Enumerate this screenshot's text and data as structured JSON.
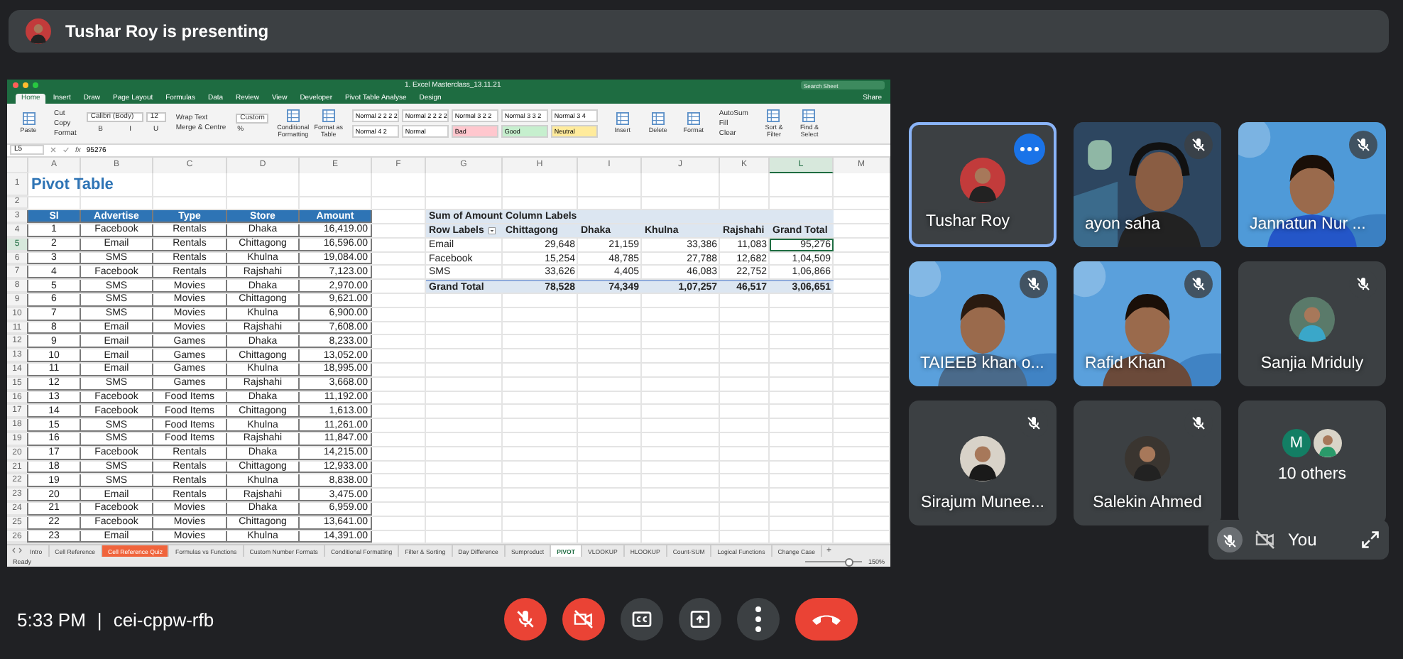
{
  "banner": {
    "text": "Tushar Roy is presenting"
  },
  "excel": {
    "title": "1. Excel Masterclass_13.11.21",
    "search": {
      "placeholder": "Search Sheet"
    },
    "share": "Share",
    "tabs": [
      {
        "label": "Home",
        "selected": true
      },
      {
        "label": "Insert",
        "selected": false
      },
      {
        "label": "Draw",
        "selected": false
      },
      {
        "label": "Page Layout",
        "selected": false
      },
      {
        "label": "Formulas",
        "selected": false
      },
      {
        "label": "Data",
        "selected": false
      },
      {
        "label": "Review",
        "selected": false
      },
      {
        "label": "View",
        "selected": false
      },
      {
        "label": "Developer",
        "selected": false
      },
      {
        "label": "Pivot Table Analyse",
        "selected": false
      },
      {
        "label": "Design",
        "selected": false
      }
    ],
    "ribbon": [
      {
        "kind": "row",
        "items": [
          {
            "kind": "big",
            "label": "Paste"
          }
        ]
      },
      {
        "kind": "stack",
        "items": [
          {
            "kind": "small",
            "label": "Cut"
          },
          {
            "kind": "small",
            "label": "Copy"
          },
          {
            "kind": "small",
            "label": "Format"
          }
        ]
      },
      {
        "kind": "grid2",
        "items": [
          {
            "kind": "field",
            "label": "Calibri (Body)"
          },
          {
            "kind": "field",
            "label": "12"
          },
          {
            "kind": "small",
            "label": "B"
          },
          {
            "kind": "small",
            "label": "I"
          },
          {
            "kind": "small",
            "label": "U"
          }
        ]
      },
      {
        "kind": "stack",
        "items": [
          {
            "kind": "small",
            "label": "Wrap Text"
          },
          {
            "kind": "small",
            "label": "Merge & Centre"
          }
        ]
      },
      {
        "kind": "stack",
        "items": [
          {
            "kind": "field",
            "label": "Custom"
          },
          {
            "kind": "small",
            "label": "%"
          }
        ]
      },
      {
        "kind": "row",
        "items": [
          {
            "kind": "big",
            "label": "Conditional Formatting"
          },
          {
            "kind": "big",
            "label": "Format as Table"
          }
        ]
      },
      {
        "kind": "styles",
        "items": [
          {
            "kind": "style",
            "label": "Normal 2 2 2 2",
            "color": "#ffffff"
          },
          {
            "kind": "style",
            "label": "Normal 2 2 2 2",
            "color": "#ffffff"
          },
          {
            "kind": "style",
            "label": "Normal 3 2 2",
            "color": "#ffffff"
          },
          {
            "kind": "style",
            "label": "Normal 3 3 2",
            "color": "#ffffff"
          },
          {
            "kind": "style",
            "label": "Normal 3 4",
            "color": "#ffffff"
          },
          {
            "kind": "style",
            "label": "Normal 4 2",
            "color": "#ffffff"
          },
          {
            "kind": "style",
            "label": "Normal",
            "color": "#ffffff"
          },
          {
            "kind": "style",
            "label": "Bad",
            "color": "#ffc7ce"
          },
          {
            "kind": "style",
            "label": "Good",
            "color": "#c6efce"
          },
          {
            "kind": "style",
            "label": "Neutral",
            "color": "#ffeb9c"
          }
        ]
      },
      {
        "kind": "row",
        "items": [
          {
            "kind": "big",
            "label": "Insert"
          },
          {
            "kind": "big",
            "label": "Delete"
          },
          {
            "kind": "big",
            "label": "Format"
          }
        ]
      },
      {
        "kind": "stack",
        "items": [
          {
            "kind": "small",
            "label": "AutoSum"
          },
          {
            "kind": "small",
            "label": "Fill"
          },
          {
            "kind": "small",
            "label": "Clear"
          }
        ]
      },
      {
        "kind": "row",
        "items": [
          {
            "kind": "big",
            "label": "Sort & Filter"
          },
          {
            "kind": "big",
            "label": "Find & Select"
          }
        ]
      }
    ],
    "formula_bar": {
      "cell": "L5",
      "function_label": "fx",
      "value": "95276"
    },
    "sheet": {
      "columns": [
        {
          "label": "A",
          "selected": false
        },
        {
          "label": "B",
          "selected": false
        },
        {
          "label": "C",
          "selected": false
        },
        {
          "label": "D",
          "selected": false
        },
        {
          "label": "E",
          "selected": false
        },
        {
          "label": "F",
          "selected": false
        },
        {
          "label": "G",
          "selected": false
        },
        {
          "label": "H",
          "selected": false
        },
        {
          "label": "I",
          "selected": false
        },
        {
          "label": "J",
          "selected": false
        },
        {
          "label": "K",
          "selected": false
        },
        {
          "label": "L",
          "selected": true
        },
        {
          "label": "M",
          "selected": false
        }
      ],
      "row_numbers": [
        {
          "label": "1",
          "selected": false
        },
        {
          "label": "2",
          "selected": false
        },
        {
          "label": "3",
          "selected": false
        },
        {
          "label": "4",
          "selected": false
        },
        {
          "label": "5",
          "selected": true
        },
        {
          "label": "6",
          "selected": false
        },
        {
          "label": "7",
          "selected": false
        },
        {
          "label": "8",
          "selected": false
        },
        {
          "label": "9",
          "selected": false
        },
        {
          "label": "10",
          "selected": false
        },
        {
          "label": "11",
          "selected": false
        },
        {
          "label": "12",
          "selected": false
        },
        {
          "label": "13",
          "selected": false
        },
        {
          "label": "14",
          "selected": false
        },
        {
          "label": "15",
          "selected": false
        },
        {
          "label": "16",
          "selected": false
        },
        {
          "label": "17",
          "selected": false
        },
        {
          "label": "18",
          "selected": false
        },
        {
          "label": "19",
          "selected": false
        },
        {
          "label": "20",
          "selected": false
        },
        {
          "label": "21",
          "selected": false
        },
        {
          "label": "22",
          "selected": false
        },
        {
          "label": "23",
          "selected": false
        },
        {
          "label": "24",
          "selected": false
        },
        {
          "label": "25",
          "selected": false
        },
        {
          "label": "26",
          "selected": false
        }
      ],
      "title": "Pivot Table",
      "data_table": {
        "columns": [
          "Sl",
          "Advertise",
          "Type",
          "Store",
          "Amount"
        ],
        "rows": [
          [
            "1",
            "Facebook",
            "Rentals",
            "Dhaka",
            "16,419.00"
          ],
          [
            "2",
            "Email",
            "Rentals",
            "Chittagong",
            "16,596.00"
          ],
          [
            "3",
            "SMS",
            "Rentals",
            "Khulna",
            "19,084.00"
          ],
          [
            "4",
            "Facebook",
            "Rentals",
            "Rajshahi",
            "7,123.00"
          ],
          [
            "5",
            "SMS",
            "Movies",
            "Dhaka",
            "2,970.00"
          ],
          [
            "6",
            "SMS",
            "Movies",
            "Chittagong",
            "9,621.00"
          ],
          [
            "7",
            "SMS",
            "Movies",
            "Khulna",
            "6,900.00"
          ],
          [
            "8",
            "Email",
            "Movies",
            "Rajshahi",
            "7,608.00"
          ],
          [
            "9",
            "Email",
            "Games",
            "Dhaka",
            "8,233.00"
          ],
          [
            "10",
            "Email",
            "Games",
            "Chittagong",
            "13,052.00"
          ],
          [
            "11",
            "Email",
            "Games",
            "Khulna",
            "18,995.00"
          ],
          [
            "12",
            "SMS",
            "Games",
            "Rajshahi",
            "3,668.00"
          ],
          [
            "13",
            "Facebook",
            "Food Items",
            "Dhaka",
            "11,192.00"
          ],
          [
            "14",
            "Facebook",
            "Food Items",
            "Chittagong",
            "1,613.00"
          ],
          [
            "15",
            "SMS",
            "Food Items",
            "Khulna",
            "11,261.00"
          ],
          [
            "16",
            "SMS",
            "Food Items",
            "Rajshahi",
            "11,847.00"
          ],
          [
            "17",
            "Facebook",
            "Rentals",
            "Dhaka",
            "14,215.00"
          ],
          [
            "18",
            "SMS",
            "Rentals",
            "Chittagong",
            "12,933.00"
          ],
          [
            "19",
            "SMS",
            "Rentals",
            "Khulna",
            "8,838.00"
          ],
          [
            "20",
            "Email",
            "Rentals",
            "Rajshahi",
            "3,475.00"
          ],
          [
            "21",
            "Facebook",
            "Movies",
            "Dhaka",
            "6,959.00"
          ],
          [
            "22",
            "Facebook",
            "Movies",
            "Chittagong",
            "13,641.00"
          ],
          [
            "23",
            "Email",
            "Movies",
            "Khulna",
            "14,391.00"
          ]
        ]
      },
      "pivot": {
        "corner": "Sum of Amount",
        "column_labels": "Column Labels",
        "row_labels": "Row Labels",
        "columns": [
          "Chittagong",
          "Dhaka",
          "Khulna",
          "Rajshahi",
          "Grand Total"
        ],
        "rows": [
          {
            "kind": "item",
            "label": "Email",
            "values": [
              {
                "text": "29,648",
                "selected": false
              },
              {
                "text": "21,159",
                "selected": false
              },
              {
                "text": "33,386",
                "selected": false
              },
              {
                "text": "11,083",
                "selected": false
              },
              {
                "text": "95,276",
                "selected": true
              }
            ]
          },
          {
            "kind": "item",
            "label": "Facebook",
            "values": [
              {
                "text": "15,254",
                "selected": false
              },
              {
                "text": "48,785",
                "selected": false
              },
              {
                "text": "27,788",
                "selected": false
              },
              {
                "text": "12,682",
                "selected": false
              },
              {
                "text": "1,04,509",
                "selected": false
              }
            ]
          },
          {
            "kind": "item",
            "label": "SMS",
            "values": [
              {
                "text": "33,626",
                "selected": false
              },
              {
                "text": "4,405",
                "selected": false
              },
              {
                "text": "46,083",
                "selected": false
              },
              {
                "text": "22,752",
                "selected": false
              },
              {
                "text": "1,06,866",
                "selected": false
              }
            ]
          },
          {
            "kind": "total",
            "label": "Grand Total",
            "values": [
              {
                "text": "78,528",
                "selected": false
              },
              {
                "text": "74,349",
                "selected": false
              },
              {
                "text": "1,07,257",
                "selected": false
              },
              {
                "text": "46,517",
                "selected": false
              },
              {
                "text": "3,06,651",
                "selected": false
              }
            ]
          }
        ]
      }
    },
    "sheet_tabs": [
      {
        "label": "Intro",
        "selected": false
      },
      {
        "label": "Cell Reference",
        "selected": false
      },
      {
        "label": "Cell Reference Quiz",
        "selected": false,
        "color": "#f0643c"
      },
      {
        "label": "Formulas vs Functions",
        "selected": false
      },
      {
        "label": "Custom Number Formats",
        "selected": false
      },
      {
        "label": "Conditional Formatting",
        "selected": false
      },
      {
        "label": "Filter & Sorting",
        "selected": false
      },
      {
        "label": "Day Difference",
        "selected": false
      },
      {
        "label": "Sumproduct",
        "selected": false
      },
      {
        "label": "PIVOT",
        "selected": true
      },
      {
        "label": "VLOOKUP",
        "selected": false
      },
      {
        "label": "HLOOKUP",
        "selected": false
      },
      {
        "label": "Count-SUM",
        "selected": false
      },
      {
        "label": "Logical Functions",
        "selected": false
      },
      {
        "label": "Change Case",
        "selected": false
      }
    ],
    "add_sheet": "+",
    "status_bar": {
      "text": "Ready",
      "zoom": {
        "level": 0.75,
        "reading": "150%"
      }
    }
  },
  "participants": [
    {
      "name": "Tushar Roy",
      "kind": "avatar",
      "muted": false,
      "selected": true,
      "options_button": true
    },
    {
      "name": "ayon saha",
      "kind": "video",
      "muted": true,
      "selected": false,
      "options_button": false
    },
    {
      "name": "Jannatun Nur ...",
      "kind": "video",
      "muted": true,
      "selected": false,
      "options_button": false
    },
    {
      "name": "TAIEEB khan o...",
      "kind": "video",
      "muted": true,
      "selected": false,
      "options_button": false
    },
    {
      "name": "Rafid Khan",
      "kind": "video",
      "muted": true,
      "selected": false,
      "options_button": false
    },
    {
      "name": "Sanjia Mriduly",
      "kind": "avatar",
      "muted": true,
      "selected": false,
      "options_button": false
    },
    {
      "name": "Sirajum Munee...",
      "kind": "avatar",
      "muted": true,
      "selected": false,
      "options_button": false
    },
    {
      "name": "Salekin Ahmed",
      "kind": "avatar",
      "muted": true,
      "selected": false,
      "options_button": false
    }
  ],
  "others": {
    "initial": "M",
    "label": "10 others"
  },
  "self_view": {
    "label": "You",
    "muted": true,
    "camera_on": false
  },
  "meeting": {
    "time": "5:33 PM",
    "separator": "|",
    "code": "cei-cppw-rfb"
  },
  "controls": [
    {
      "kind": "mic",
      "on": false
    },
    {
      "kind": "camera",
      "on": false
    },
    {
      "kind": "captions",
      "on": false
    },
    {
      "kind": "present",
      "on": false
    },
    {
      "kind": "more"
    },
    {
      "kind": "hangup"
    }
  ]
}
